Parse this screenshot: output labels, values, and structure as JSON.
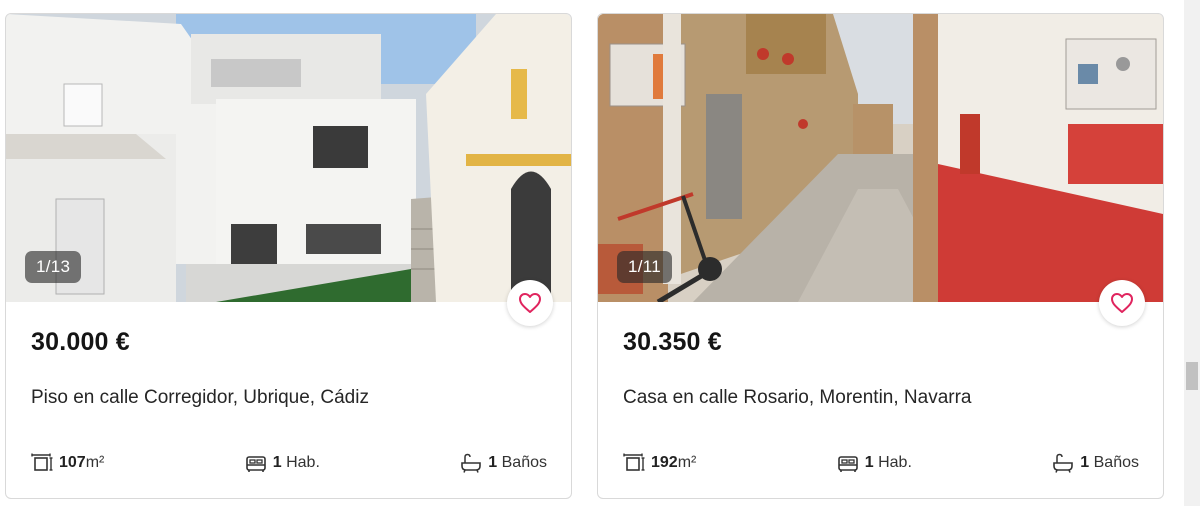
{
  "listings": [
    {
      "photo_counter": "1/13",
      "price": "30.000 €",
      "title": "Piso en calle Corregidor, Ubrique, Cádiz",
      "area_value": "107",
      "area_unit": "m²",
      "rooms_value": "1",
      "rooms_unit": "Hab.",
      "baths_value": "1",
      "baths_unit": "Baños",
      "favorite_icon": "heart-outline-icon"
    },
    {
      "photo_counter": "1/11",
      "price": "30.350 €",
      "title": "Casa en calle Rosario, Morentin, Navarra",
      "area_value": "192",
      "area_unit": "m²",
      "rooms_value": "1",
      "rooms_unit": "Hab.",
      "baths_value": "1",
      "baths_unit": "Baños",
      "favorite_icon": "heart-outline-icon"
    }
  ],
  "colors": {
    "accent_heart": "#e0245e",
    "text_dark": "#151515",
    "card_border": "#d9d9d9"
  }
}
